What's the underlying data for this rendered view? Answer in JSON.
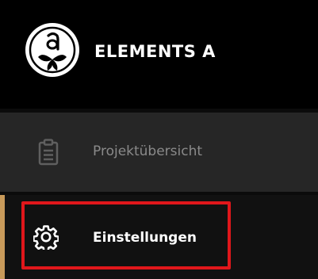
{
  "app": {
    "title": "ELEMENTS A",
    "logo_icon": "elements-a-logo-icon"
  },
  "sidebar": {
    "items": [
      {
        "label": "Projektübersicht",
        "icon": "clipboard-icon",
        "active": false
      },
      {
        "label": "Einstellungen",
        "icon": "gear-icon",
        "active": true
      }
    ]
  },
  "colors": {
    "header_background": "#000000",
    "item_background": "#262626",
    "active_item_background": "#111111",
    "active_indicator": "#c89a5a",
    "highlight_outline": "#e0171b",
    "inactive_text": "#8a8a8a",
    "active_text": "#ffffff"
  }
}
